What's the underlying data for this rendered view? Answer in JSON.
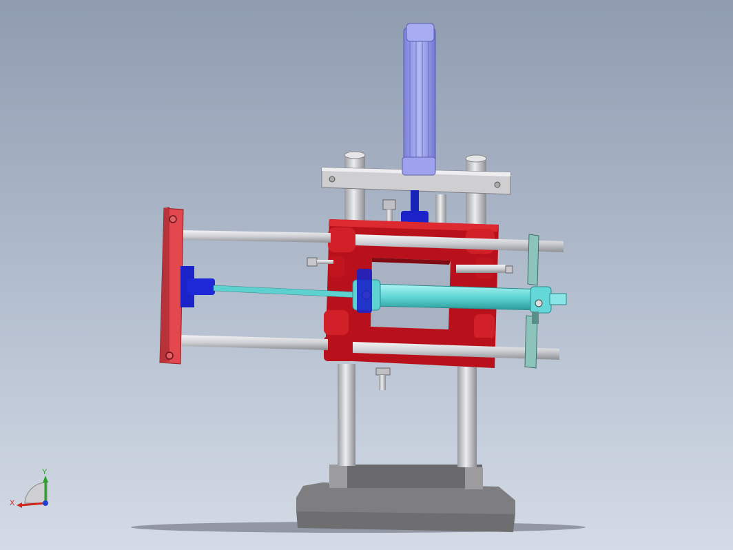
{
  "viewport": {
    "background_top": "#8f9cb0",
    "background_bottom": "#d4dbe6"
  },
  "triad": {
    "x_label": "X",
    "y_label": "Y",
    "x_color": "#d0281e",
    "y_color": "#2aa22a",
    "z_color": "#2040d0"
  },
  "colors": {
    "frame_red": "#c8141e",
    "plate_pink": "#e04a50",
    "cylinder_purple": "#9aa0ee",
    "cylinder_cyan": "#66dada",
    "clamp_blue": "#1a22c8",
    "bracket_teal": "#8cc4bc",
    "rod_gray": "#d8d8dc",
    "base_gray": "#7a7a7a"
  }
}
